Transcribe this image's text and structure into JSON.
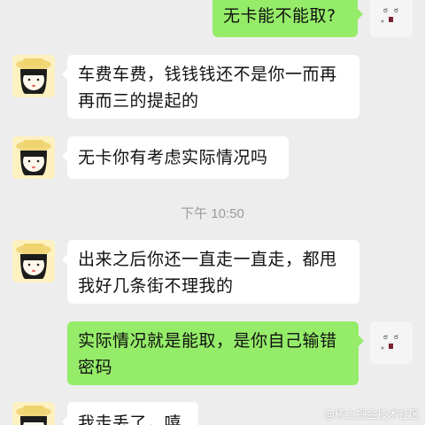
{
  "colors": {
    "background": "#ededed",
    "incoming_bubble": "#ffffff",
    "outgoing_bubble": "#95ec69",
    "timestamp_text": "#9a9a9a"
  },
  "contact": {
    "avatar_icon": "girl-with-hat-avatar-icon"
  },
  "me": {
    "avatar_icon": "kaomoji-face-avatar-icon"
  },
  "messages": [
    {
      "from": "me",
      "lines": [
        "无卡能不能取?"
      ]
    },
    {
      "from": "contact",
      "lines": [
        "车费车费，钱钱钱还不是你一而再",
        "再而三的提起的"
      ]
    },
    {
      "from": "contact",
      "lines": [
        "无卡你有考虑实际情况吗"
      ]
    },
    {
      "from": "contact",
      "lines": [
        "出来之后你还一直走一直走，都甩",
        "我好几条街不理我的"
      ]
    },
    {
      "from": "me",
      "lines": [
        "实际情况就是能取，是你自己输错",
        "密码"
      ]
    },
    {
      "from": "contact",
      "lines": [
        "我走丢了，嘻"
      ]
    }
  ],
  "timestamp": "下午 10:50",
  "watermark": "@稀土掘金技术社区"
}
